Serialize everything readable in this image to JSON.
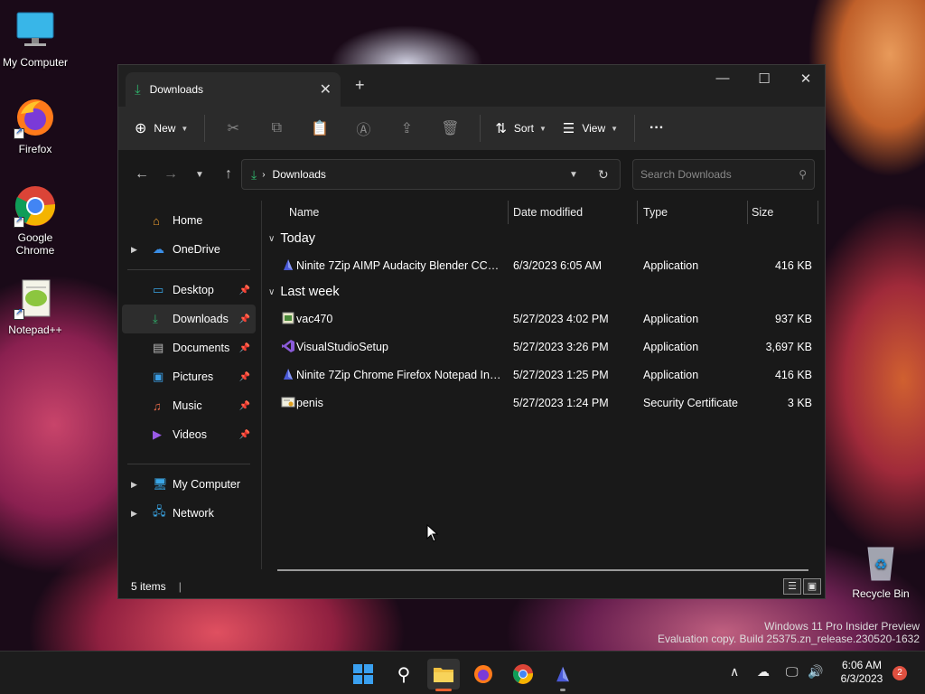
{
  "desktop": {
    "icons": [
      {
        "label": "My Computer"
      },
      {
        "label": "Firefox"
      },
      {
        "label": "Google Chrome"
      },
      {
        "label": "Notepad++"
      },
      {
        "label": "Recycle Bin"
      }
    ],
    "watermark": {
      "line1": "Windows 11 Pro Insider Preview",
      "line2": "Evaluation copy. Build 25375.zn_release.230520-1632"
    }
  },
  "window": {
    "tab_title": "Downloads",
    "tab_close": "✕",
    "new_tab": "+",
    "controls": {
      "minimize": "—",
      "maximize": "☐",
      "close": "✕"
    }
  },
  "toolbar": {
    "new_label": "New",
    "sort_label": "Sort",
    "view_label": "View",
    "more_label": "···"
  },
  "address": {
    "path": "Downloads",
    "search_placeholder": "Search Downloads"
  },
  "sidebar": {
    "items": [
      {
        "label": "Home",
        "icon": "home-icon"
      },
      {
        "label": "OneDrive",
        "icon": "cloud-icon"
      },
      {
        "label": "Desktop",
        "icon": "desktop-icon"
      },
      {
        "label": "Downloads",
        "icon": "download-icon"
      },
      {
        "label": "Documents",
        "icon": "document-icon"
      },
      {
        "label": "Pictures",
        "icon": "picture-icon"
      },
      {
        "label": "Music",
        "icon": "music-icon"
      },
      {
        "label": "Videos",
        "icon": "video-icon"
      },
      {
        "label": "My Computer",
        "icon": "computer-icon"
      },
      {
        "label": "Network",
        "icon": "network-icon"
      }
    ]
  },
  "columns": {
    "name": "Name",
    "date": "Date modified",
    "type": "Type",
    "size": "Size"
  },
  "groups": [
    {
      "label": "Today",
      "files": [
        {
          "name": "Ninite 7Zip AIMP Audacity Blender CCCP...",
          "date": "6/3/2023 6:05 AM",
          "type": "Application",
          "size": "416 KB"
        }
      ]
    },
    {
      "label": "Last week",
      "files": [
        {
          "name": "vac470",
          "date": "5/27/2023 4:02 PM",
          "type": "Application",
          "size": "937 KB"
        },
        {
          "name": "VisualStudioSetup",
          "date": "5/27/2023 3:26 PM",
          "type": "Application",
          "size": "3,697 KB"
        },
        {
          "name": "Ninite 7Zip Chrome Firefox Notepad Inst...",
          "date": "5/27/2023 1:25 PM",
          "type": "Application",
          "size": "416 KB"
        },
        {
          "name": "penis",
          "date": "5/27/2023 1:24 PM",
          "type": "Security Certificate",
          "size": "3 KB"
        }
      ]
    }
  ],
  "status": {
    "items": "5 items"
  },
  "taskbar": {
    "time": "6:06 AM",
    "date": "6/3/2023",
    "notification_count": "2"
  },
  "colors": {
    "accent": "#0078d4",
    "download_green": "#2fb36b"
  }
}
